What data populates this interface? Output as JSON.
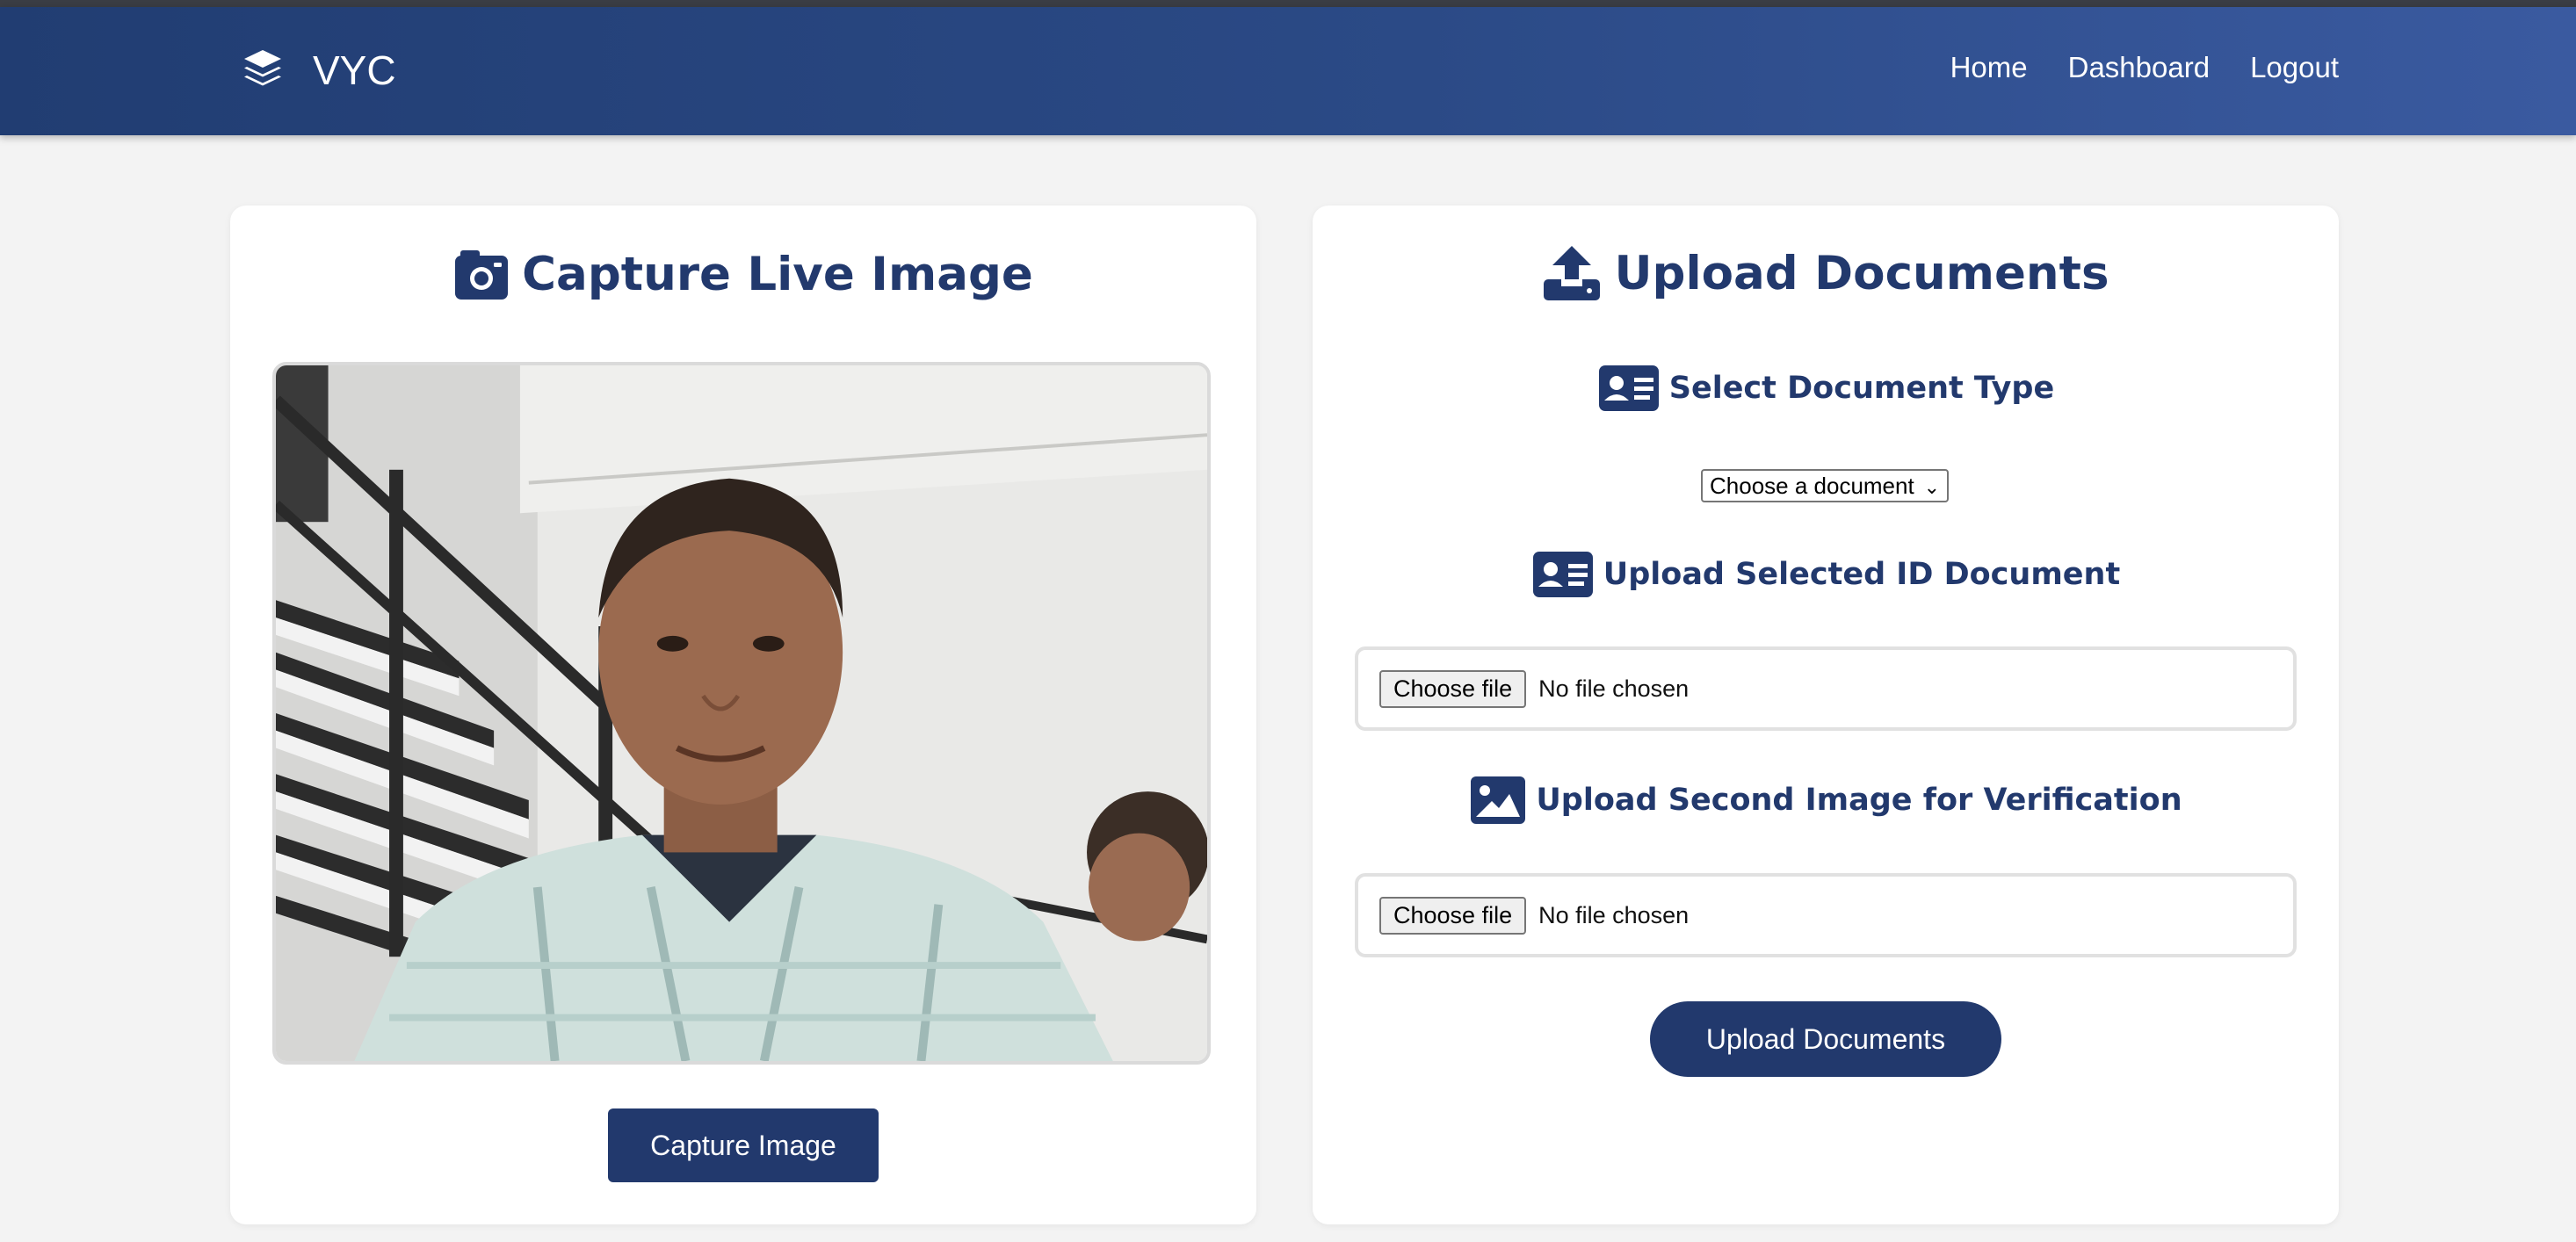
{
  "brand": {
    "name": "VYC",
    "logo_icon": "layers-icon"
  },
  "nav": {
    "home": "Home",
    "dashboard": "Dashboard",
    "logout": "Logout"
  },
  "capture": {
    "title": "Capture Live Image",
    "title_icon": "camera-icon",
    "button_label": "Capture Image"
  },
  "upload": {
    "title": "Upload Documents",
    "title_icon": "upload-icon",
    "select_heading": "Select Document Type",
    "select_value": "Choose a document",
    "id_heading": "Upload Selected ID Document",
    "id_file_button": "Choose file",
    "id_file_status": "No file chosen",
    "second_heading": "Upload Second Image for Verification",
    "second_file_button": "Choose file",
    "second_file_status": "No file chosen",
    "submit_label": "Upload Documents"
  },
  "colors": {
    "primary": "#22396d",
    "nav_start": "#213d72",
    "nav_end": "#3a5aa0",
    "page_bg": "#f3f3f3"
  }
}
